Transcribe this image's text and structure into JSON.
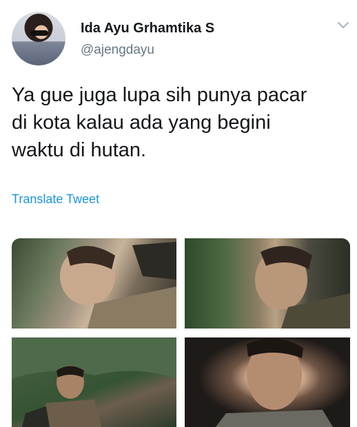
{
  "user": {
    "name": "Ida Ayu Grhamtika S",
    "handle": "@ajengdayu",
    "avatar_icon": "profile-photo"
  },
  "tweet": {
    "lines": [
      "Ya gue juga lupa sih punya pacar",
      "di kota kalau ada yang begini",
      "waktu di hutan."
    ],
    "translate_label": "Translate Tweet"
  },
  "menu_icon": "chevron-down-icon",
  "colors": {
    "name": "#14171a",
    "handle": "#657786",
    "link": "#1b95e0",
    "chevron": "#aab8c2"
  },
  "media": [
    {
      "label": "photo-1"
    },
    {
      "label": "photo-2"
    },
    {
      "label": "photo-3"
    },
    {
      "label": "photo-4"
    }
  ]
}
